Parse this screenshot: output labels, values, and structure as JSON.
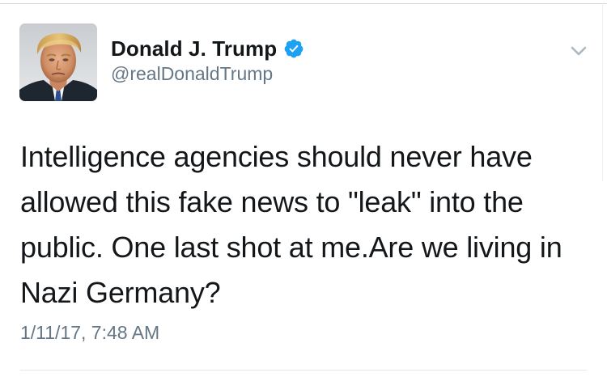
{
  "tweet": {
    "author": {
      "display_name": "Donald J. Trump",
      "handle": "@realDonaldTrump",
      "verified": true,
      "verified_icon": "verified-badge-icon",
      "avatar": "profile-photo"
    },
    "menu_icon": "chevron-down-icon",
    "text": "Intelligence agencies should never have allowed this fake news to \"leak\" into the public. One last shot at me.Are we living in Nazi Germany?",
    "timestamp": "1/11/17, 7:48 AM"
  },
  "colors": {
    "text_primary": "#14171a",
    "text_secondary": "#657786",
    "verified_blue": "#1da1f2",
    "divider": "#e1e8ed",
    "chevron": "#aab8c2"
  }
}
